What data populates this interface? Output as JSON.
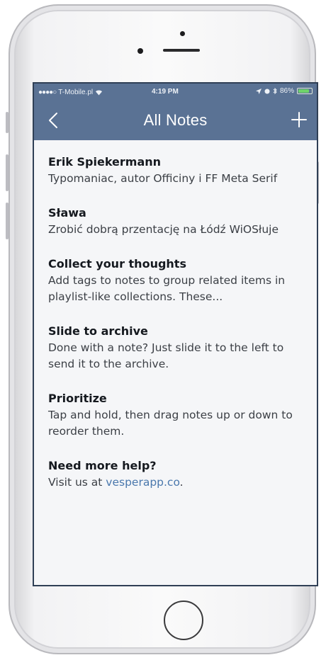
{
  "status_bar": {
    "carrier": "T-Mobile.pl",
    "time": "4:19 PM",
    "battery": "86%",
    "battery_level": 0.86
  },
  "nav": {
    "title": "All Notes",
    "back_icon": "chevron-left-icon",
    "add_icon": "plus-icon"
  },
  "notes": [
    {
      "title": "Erik Spiekermann",
      "body": "Typomaniac, autor Officiny i FF Meta Serif"
    },
    {
      "title": "Sława",
      "body": "Zrobić dobrą przentację na Łódź WiOSłuje"
    },
    {
      "title": "Collect your thoughts",
      "body": "Add tags to notes to group related items in playlist-like collections. These..."
    },
    {
      "title": "Slide to archive",
      "body": "Done with a note? Just slide it to the left to send it to the archive."
    },
    {
      "title": "Prioritize",
      "body": "Tap and hold, then drag notes up or down to reorder them."
    },
    {
      "title": "Need more help?",
      "body_prefix": "Visit us at ",
      "body_link": "vesperapp.co",
      "body_suffix": "."
    }
  ],
  "colors": {
    "nav_background": "#5a7294",
    "screen_background": "#f5f6f8",
    "link": "#4a78ad"
  }
}
